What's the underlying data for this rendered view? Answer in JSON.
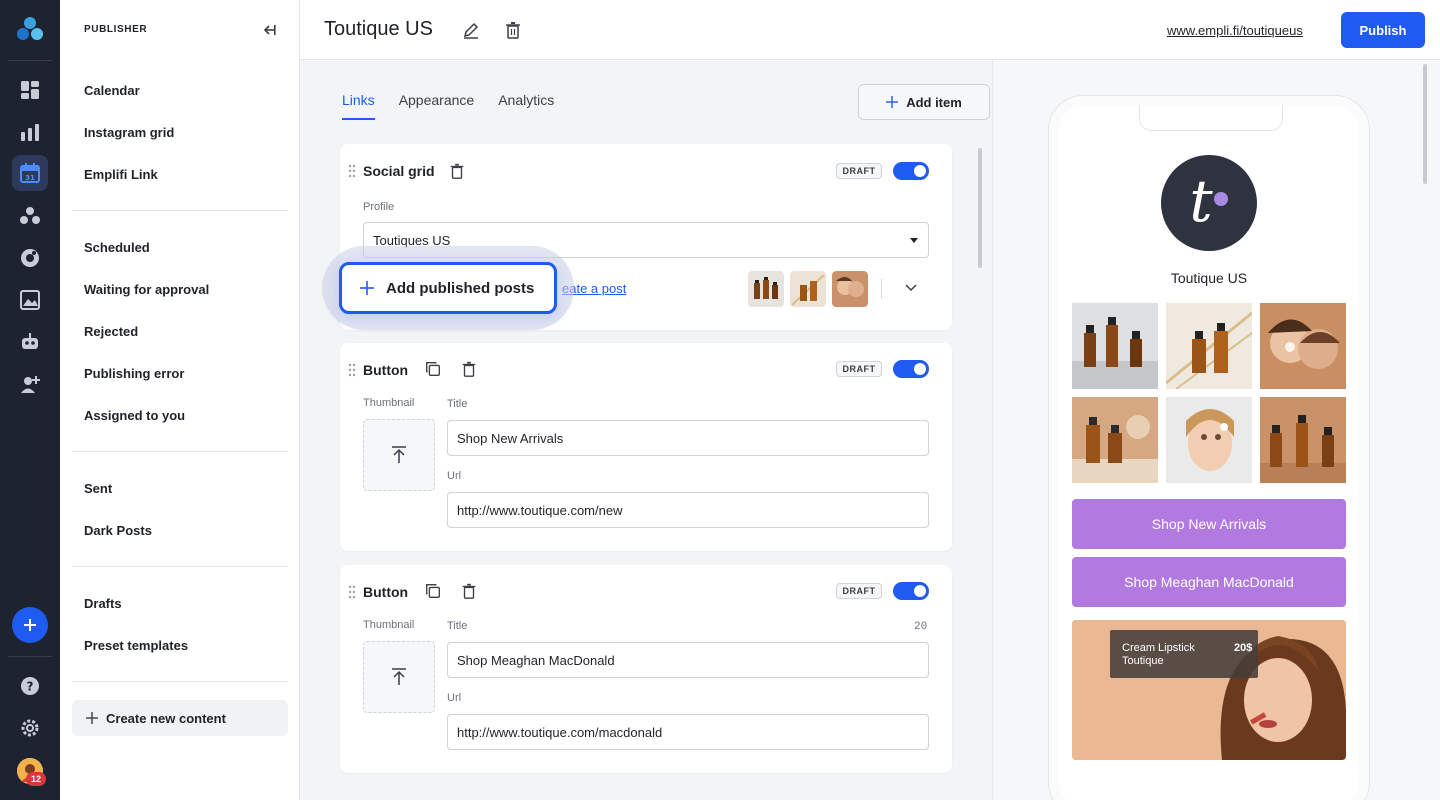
{
  "rail": {
    "notification_count": "12"
  },
  "sidebar": {
    "header": "PUBLISHER",
    "group1": [
      "Calendar",
      "Instagram grid",
      "Emplifi Link"
    ],
    "group2": [
      "Scheduled",
      "Waiting for approval",
      "Rejected",
      "Publishing error",
      "Assigned to you"
    ],
    "group3": [
      "Sent",
      "Dark Posts"
    ],
    "group4": [
      "Drafts",
      "Preset templates"
    ],
    "create_label": "Create new content"
  },
  "topbar": {
    "title": "Toutique US",
    "link": "www.empli.fi/toutiqueus",
    "publish_label": "Publish"
  },
  "editor": {
    "tabs": [
      "Links",
      "Appearance",
      "Analytics"
    ],
    "active_tab": "Links",
    "add_item_label": "Add item",
    "social_grid": {
      "title": "Social grid",
      "badge": "DRAFT",
      "enabled": true,
      "profile_label": "Profile",
      "profile_value": "Toutiques US",
      "create_post_link": "eate a post",
      "add_posts_label": "Add published posts"
    },
    "buttons": [
      {
        "title": "Button",
        "badge": "DRAFT",
        "enabled": true,
        "thumbnail_label": "Thumbnail",
        "title_label": "Title",
        "title_value": "Shop New Arrivals",
        "url_label": "Url",
        "url_value": "http://www.toutique.com/new",
        "counter": ""
      },
      {
        "title": "Button",
        "badge": "DRAFT",
        "enabled": true,
        "thumbnail_label": "Thumbnail",
        "title_label": "Title",
        "title_value": "Shop Meaghan MacDonald",
        "url_label": "Url",
        "url_value": "http://www.toutique.com/macdonald",
        "counter": "20"
      }
    ]
  },
  "preview": {
    "profile_name": "Toutique US",
    "buttons": [
      "Shop New Arrivals",
      "Shop Meaghan MacDonald"
    ],
    "product_name": "Cream Lipstick\nToutique",
    "product_price": "20$",
    "accent_color": "#b27ae0",
    "primary_color": "#1f5bf0"
  }
}
